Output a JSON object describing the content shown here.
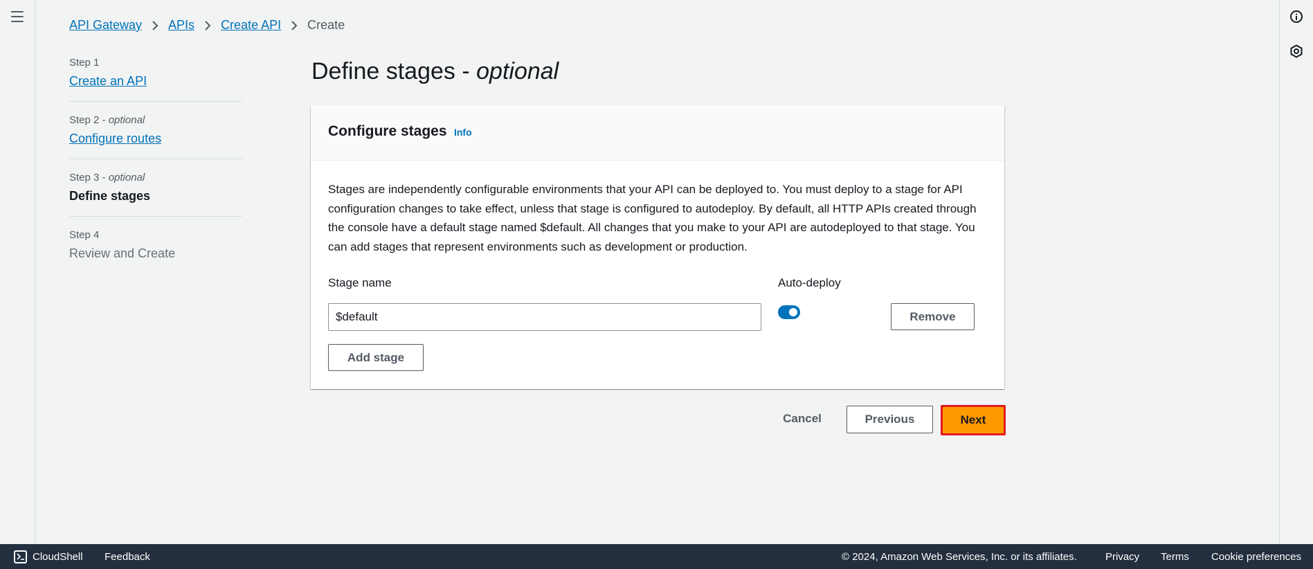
{
  "breadcrumb": {
    "items": [
      "API Gateway",
      "APIs",
      "Create API"
    ],
    "current": "Create"
  },
  "steps": [
    {
      "label": "Step 1",
      "optional": "",
      "title": "Create an API"
    },
    {
      "label": "Step 2 - ",
      "optional": "optional",
      "title": "Configure routes"
    },
    {
      "label": "Step 3 - ",
      "optional": "optional",
      "title": "Define stages"
    },
    {
      "label": "Step 4",
      "optional": "",
      "title": "Review and Create"
    }
  ],
  "page": {
    "title": "Define stages - ",
    "title_optional": "optional"
  },
  "card": {
    "title": "Configure stages",
    "info": "Info",
    "description": "Stages are independently configurable environments that your API can be deployed to. You must deploy to a stage for API configuration changes to take effect, unless that stage is configured to autodeploy. By default, all HTTP APIs created through the console have a default stage named $default. All changes that you make to your API are autodeployed to that stage. You can add stages that represent environments such as development or production.",
    "stage_name_label": "Stage name",
    "auto_deploy_label": "Auto-deploy",
    "stage_name_value": "$default",
    "auto_deploy_on": true,
    "remove_label": "Remove",
    "add_stage_label": "Add stage"
  },
  "actions": {
    "cancel": "Cancel",
    "previous": "Previous",
    "next": "Next"
  },
  "footer": {
    "cloudshell": "CloudShell",
    "feedback": "Feedback",
    "copyright": "© 2024, Amazon Web Services, Inc. or its affiliates.",
    "privacy": "Privacy",
    "terms": "Terms",
    "cookies": "Cookie preferences"
  },
  "colors": {
    "link": "#0073bb",
    "primary_button": "#ff9900",
    "highlight_border": "#e01b24",
    "footer_bg": "#232f3e"
  }
}
